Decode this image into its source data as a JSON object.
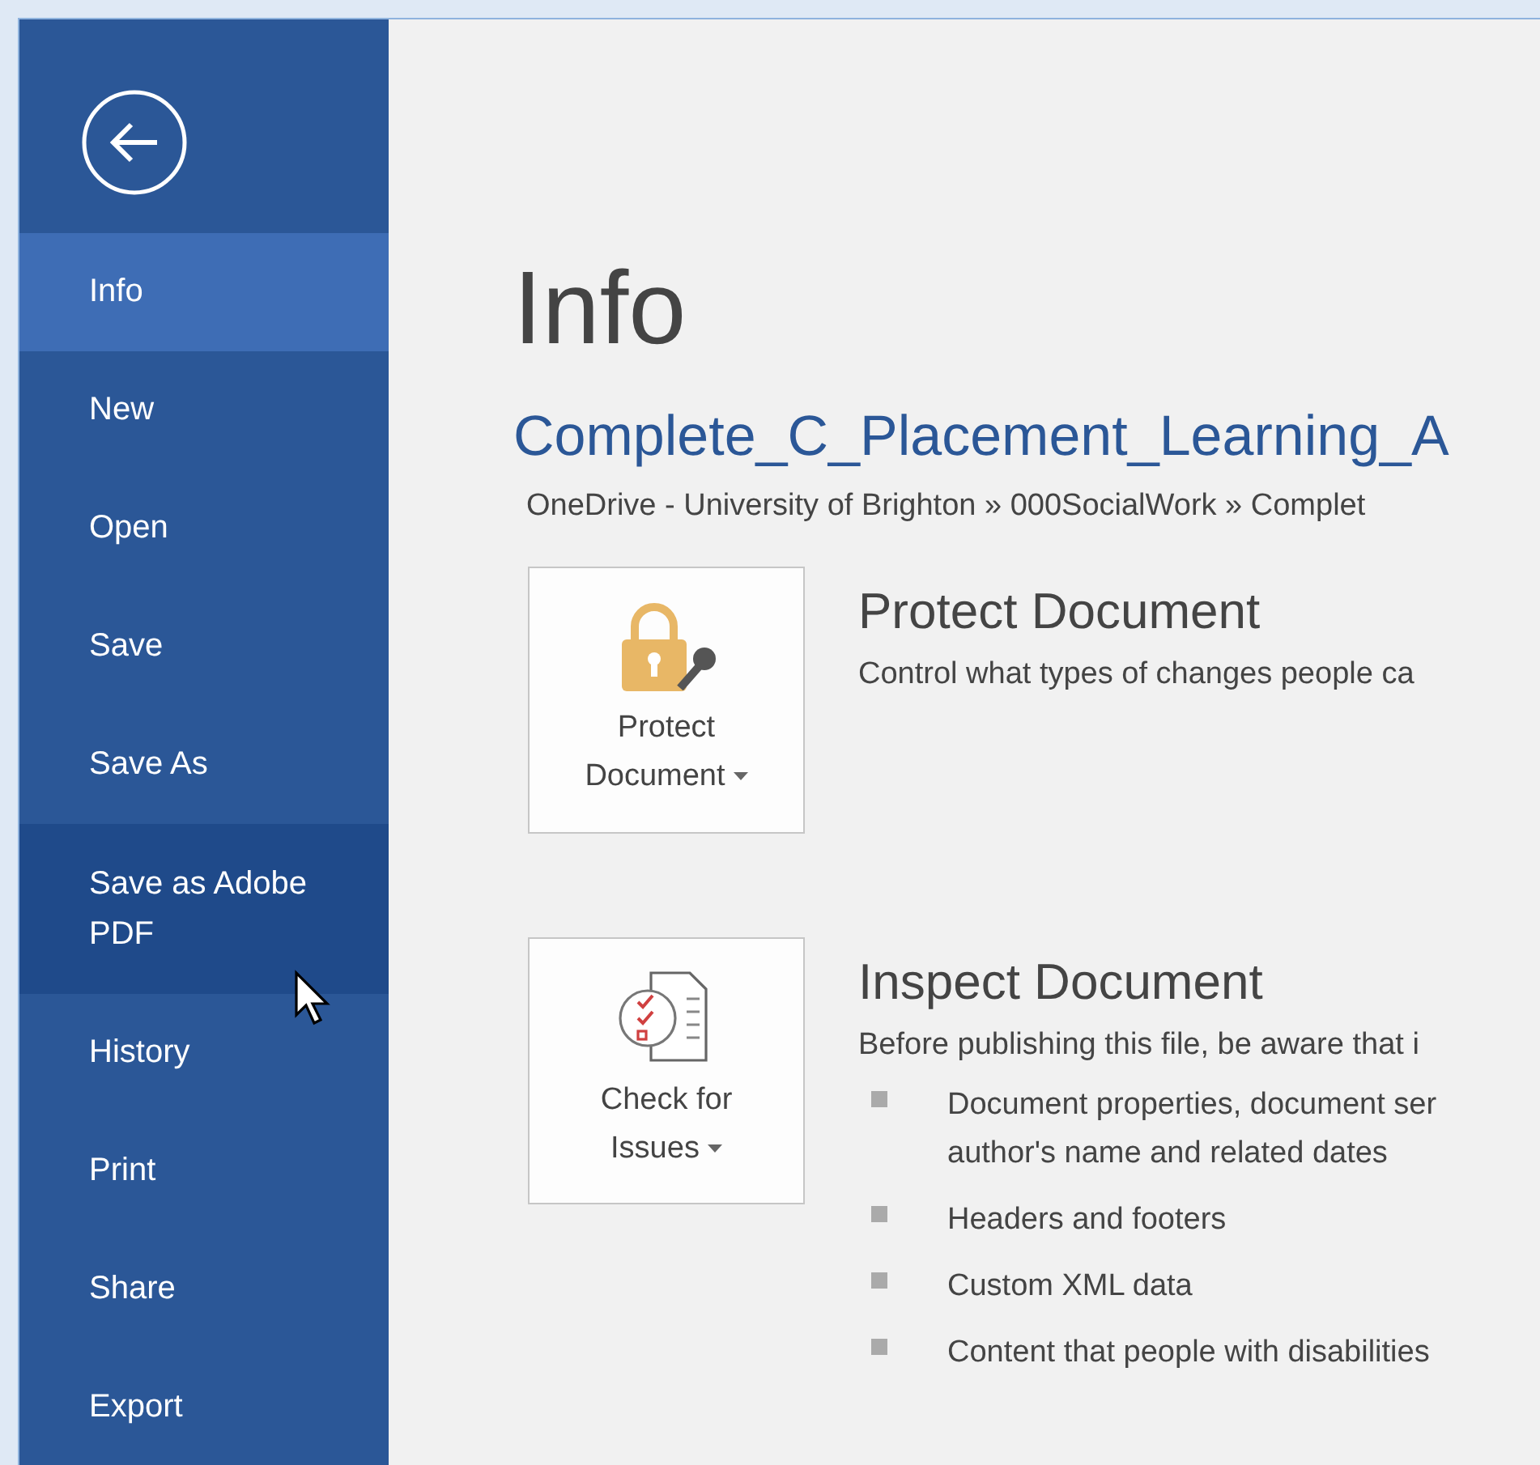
{
  "sidebar": {
    "items": [
      {
        "label": "Info",
        "selected": true,
        "hovered": false
      },
      {
        "label": "New",
        "selected": false,
        "hovered": false
      },
      {
        "label": "Open",
        "selected": false,
        "hovered": false
      },
      {
        "label": "Save",
        "selected": false,
        "hovered": false
      },
      {
        "label": "Save As",
        "selected": false,
        "hovered": false
      },
      {
        "label": "Save as Adobe PDF",
        "selected": false,
        "hovered": true
      },
      {
        "label": "History",
        "selected": false,
        "hovered": false
      },
      {
        "label": "Print",
        "selected": false,
        "hovered": false
      },
      {
        "label": "Share",
        "selected": false,
        "hovered": false
      },
      {
        "label": "Export",
        "selected": false,
        "hovered": false
      }
    ]
  },
  "title": "Info",
  "document": {
    "name": "Complete_C_Placement_Learning_A",
    "path": "OneDrive - University of Brighton » 000SocialWork » Complet"
  },
  "sections": [
    {
      "kind": "protect",
      "button": "Protect Document",
      "heading": "Protect Document",
      "description": "Control what types of changes people ca"
    },
    {
      "kind": "inspect",
      "button": "Check for Issues",
      "heading": "Inspect Document",
      "description": "Before publishing this file, be aware that i",
      "bullets": [
        "Document properties, document ser\nauthor's name and related dates",
        "Headers and footers",
        "Custom XML data",
        "Content that people with disabilities"
      ]
    }
  ]
}
